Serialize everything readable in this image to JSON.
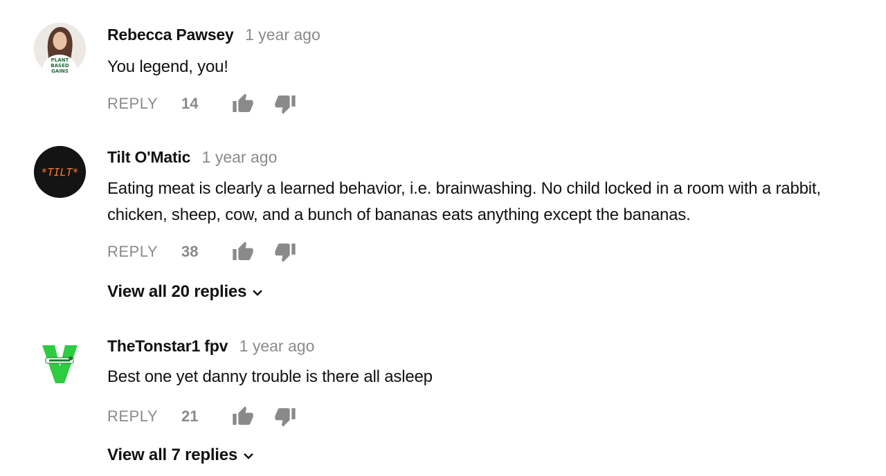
{
  "comments": [
    {
      "author": "Rebecca Pawsey",
      "time": "1 year ago",
      "text": "You legend, you!",
      "reply_label": "REPLY",
      "likes": "14",
      "avatar_icon": "avatar-plant-based-gains",
      "avatar_text": [
        "PLANT",
        "BASED",
        "GAINS"
      ]
    },
    {
      "author": "Tilt O'Matic",
      "time": "1 year ago",
      "text": "Eating meat is clearly a learned behavior, i.e. brainwashing.  No child locked in a room with a rabbit, chicken, sheep, cow, and a bunch of bananas eats anything except the bananas.",
      "reply_label": "REPLY",
      "likes": "38",
      "view_replies": "View all 20 replies",
      "avatar_icon": "avatar-tilt-logo",
      "avatar_text": "*TILT*"
    },
    {
      "author": "TheTonstar1 fpv",
      "time": "1 year ago",
      "text": "Best one yet danny trouble is there all asleep",
      "reply_label": "REPLY",
      "likes": "21",
      "view_replies": "View all 7 replies",
      "avatar_icon": "avatar-green-v-logo"
    }
  ],
  "colors": {
    "author": "#111111",
    "meta": "#8a8a8a",
    "icon": "#8a8a8a",
    "v_logo": "#2ecc40"
  }
}
